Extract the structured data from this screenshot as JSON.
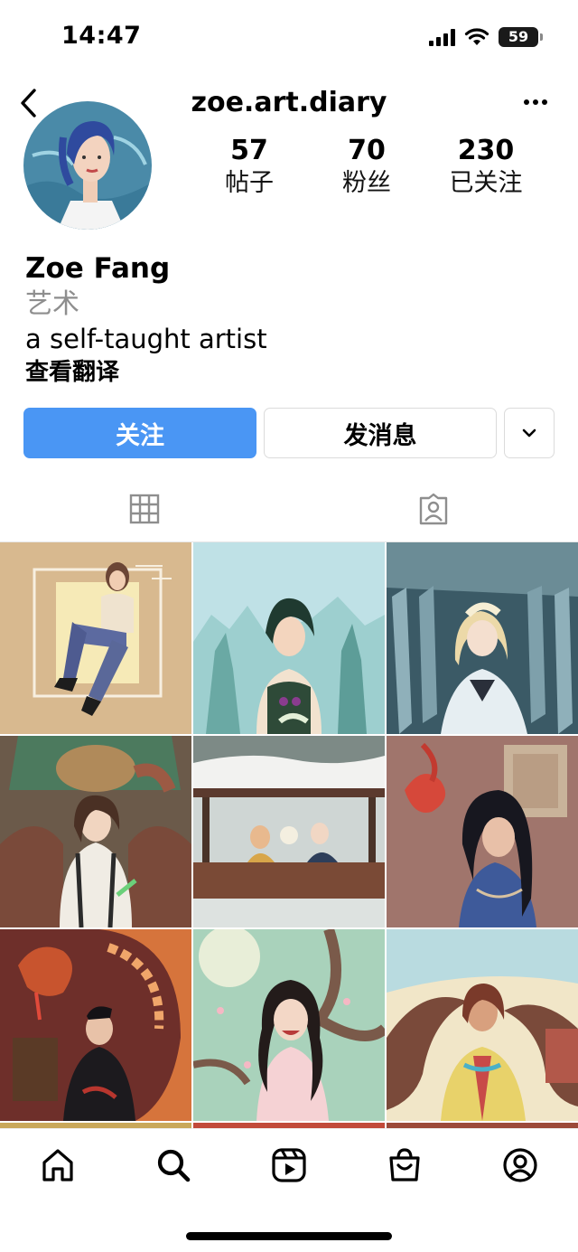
{
  "status_bar": {
    "time": "14:47",
    "battery_level": "59",
    "icons": [
      "cellular-signal-icon",
      "wifi-icon",
      "battery-icon"
    ]
  },
  "header": {
    "username": "zoe.art.diary",
    "back_icon": "chevron-left-icon",
    "more_icon": "more-dots-icon"
  },
  "profile": {
    "stats": [
      {
        "value": "57",
        "label": "帖子"
      },
      {
        "value": "70",
        "label": "粉丝"
      },
      {
        "value": "230",
        "label": "已关注"
      }
    ],
    "name": "Zoe Fang",
    "category": "艺术",
    "bio": "a self-taught artist",
    "translate_link": "查看翻译"
  },
  "actions": {
    "follow_label": "关注",
    "message_label": "发消息",
    "more_icon": "chevron-down-icon"
  },
  "tabs": [
    {
      "icon": "grid-icon",
      "active": true
    },
    {
      "icon": "tagged-person-icon",
      "active": false
    }
  ],
  "posts": [
    {
      "subject": "figure seated on frame, beige background"
    },
    {
      "subject": "green-haired warrior, misty mountains"
    },
    {
      "subject": "blonde figure, blue pillars"
    },
    {
      "subject": "figure with suspenders before giant"
    },
    {
      "subject": "two figures on snowy balcony"
    },
    {
      "subject": "dark-haired girl with red fish"
    },
    {
      "subject": "figure with orange dragon"
    },
    {
      "subject": "laughing girl with blossom branch"
    },
    {
      "subject": "figure with swirling branches"
    }
  ],
  "colors": {
    "accent": "#4a96f4",
    "secondary_text": "#8e8e8e",
    "border": "#dbdbdb"
  },
  "bottom_nav": [
    {
      "icon": "home-icon"
    },
    {
      "icon": "search-icon"
    },
    {
      "icon": "reels-icon"
    },
    {
      "icon": "shop-icon"
    },
    {
      "icon": "profile-icon"
    }
  ]
}
